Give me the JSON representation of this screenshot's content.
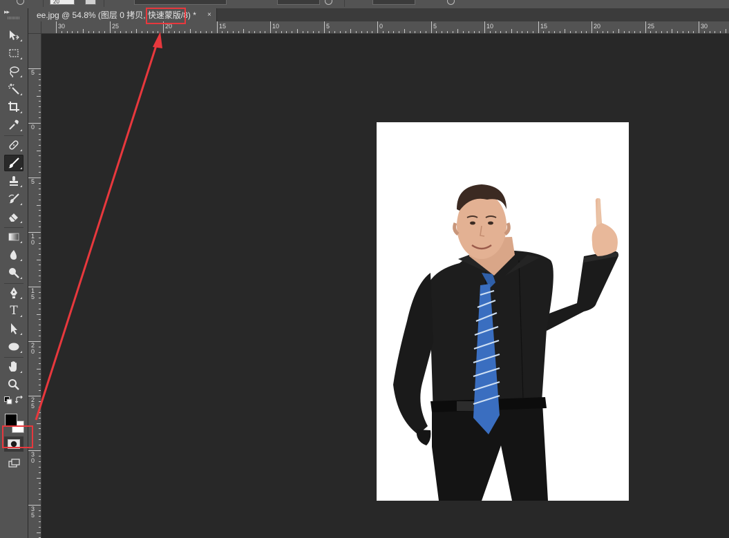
{
  "options_bar": {
    "brush_size_value": "20"
  },
  "toolbar": {
    "collapse_glyph": "▸▸",
    "tools": [
      {
        "name": "move-tool",
        "icon": "move-icon"
      },
      {
        "name": "marquee-tool",
        "icon": "rect-marquee-icon"
      },
      {
        "name": "lasso-tool",
        "icon": "lasso-icon"
      },
      {
        "name": "magic-wand-tool",
        "icon": "magic-wand-icon"
      },
      {
        "name": "crop-tool",
        "icon": "crop-icon"
      },
      {
        "name": "eyedropper-tool",
        "icon": "eyedropper-icon"
      },
      {
        "name": "healing-brush-tool",
        "icon": "bandage-icon"
      },
      {
        "name": "brush-tool",
        "icon": "brush-icon",
        "active": true
      },
      {
        "name": "clone-stamp-tool",
        "icon": "stamp-icon"
      },
      {
        "name": "history-brush-tool",
        "icon": "history-brush-icon"
      },
      {
        "name": "eraser-tool",
        "icon": "eraser-icon"
      },
      {
        "name": "gradient-tool",
        "icon": "gradient-icon"
      },
      {
        "name": "blur-tool",
        "icon": "blur-drop-icon"
      },
      {
        "name": "dodge-tool",
        "icon": "dodge-icon"
      },
      {
        "name": "pen-tool",
        "icon": "pen-icon"
      },
      {
        "name": "type-tool",
        "icon": "type-icon",
        "glyph": "T"
      },
      {
        "name": "path-selection-tool",
        "icon": "arrow-pointer-icon"
      },
      {
        "name": "ellipse-tool",
        "icon": "ellipse-icon"
      },
      {
        "name": "hand-tool",
        "icon": "hand-icon"
      },
      {
        "name": "zoom-tool",
        "icon": "magnifier-icon"
      }
    ],
    "foreground_color": "#000000",
    "background_color": "#ffffff",
    "quick_mask_button": "quick-mask-icon",
    "screen_mode_button": "screen-mode-icon"
  },
  "document_tab": {
    "title": "ee.jpg @ 54.8% (图层 0 拷贝, 快速蒙版/8) *",
    "close_glyph": "×"
  },
  "rulers": {
    "horizontal_labels": [
      "30",
      "25",
      "20",
      "15",
      "10",
      "5",
      "0",
      "5",
      "10",
      "15",
      "20",
      "25",
      "30"
    ],
    "vertical_labels": [
      [
        "5"
      ],
      [
        "0"
      ],
      [
        "5"
      ],
      [
        "1",
        "0"
      ],
      [
        "1",
        "5"
      ],
      [
        "2",
        "0"
      ],
      [
        "2",
        "5"
      ],
      [
        "3",
        "0"
      ],
      [
        "3",
        "5"
      ]
    ]
  },
  "colors": {
    "highlight": "#e8383d",
    "panel": "#535353",
    "canvas_bg": "#282828"
  },
  "annotations": {
    "highlighted_tab_text": "快速蒙版",
    "highlighted_button": "quick-mask-button"
  }
}
